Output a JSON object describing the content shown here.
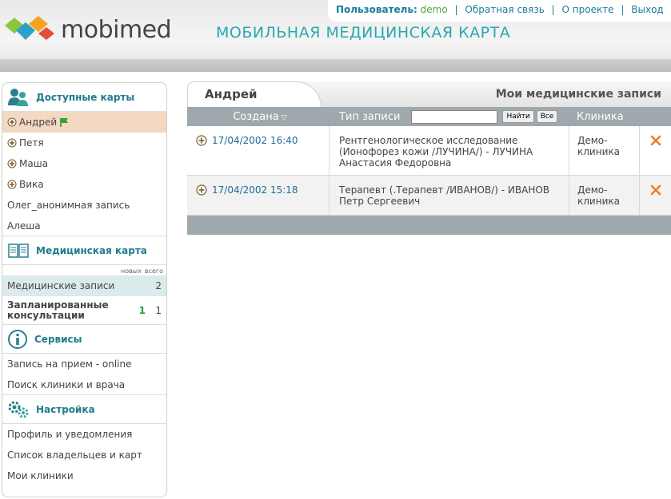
{
  "header": {
    "brand": "mobimed",
    "tagline": "МОБИЛЬНАЯ МЕДИЦИНСКАЯ КАРТА",
    "user_label": "Пользователь:",
    "user_name": "demo",
    "links": [
      "Обратная связь",
      "О проекте",
      "Выход"
    ]
  },
  "sidebar": {
    "cards": {
      "title": "Доступные карты",
      "items": [
        "Андрей",
        "Петя",
        "Маша",
        "Вика",
        "Олег_анонимная запись",
        "Алеша"
      ]
    },
    "medcard": {
      "title": "Медицинская карта",
      "col_new": "новых",
      "col_all": "всего",
      "records": {
        "label": "Медицинские записи",
        "new": "",
        "all": "2"
      },
      "consults": {
        "label": "Запланированные консультации",
        "new": "1",
        "all": "1"
      }
    },
    "services": {
      "title": "Сервисы",
      "items": [
        "Запись на прием - online",
        "Поиск клиники и врача"
      ]
    },
    "settings": {
      "title": "Настройка",
      "items": [
        "Профиль и уведомления",
        "Список владельцев и карт",
        "Мои клиники"
      ]
    }
  },
  "main": {
    "tab": "Андрей",
    "section_title": "Мои медицинские записи",
    "columns": {
      "created": "Создана",
      "type": "Тип записи",
      "clinic": "Клиника"
    },
    "filter": {
      "placeholder": "",
      "find": "Найти",
      "all": "Все"
    },
    "rows": [
      {
        "date": "17/04/2002 16:40",
        "type": "Рентгенологическое исследование (Ионофорез кожи /ЛУЧИНА/) - ЛУЧИНА Анастасия Федоровна",
        "clinic": "Демо-клиника"
      },
      {
        "date": "17/04/2002 15:18",
        "type": "Терапевт (.Терапевт /ИВАНОВ/) - ИВАНОВ Петр Сергеевич",
        "clinic": "Демо-клиника"
      }
    ]
  },
  "colors": {
    "accent": "#1f7c8c",
    "tagline": "#2aa8b2",
    "delete": "#f07b2c",
    "active_card": "#f3d8c2"
  }
}
